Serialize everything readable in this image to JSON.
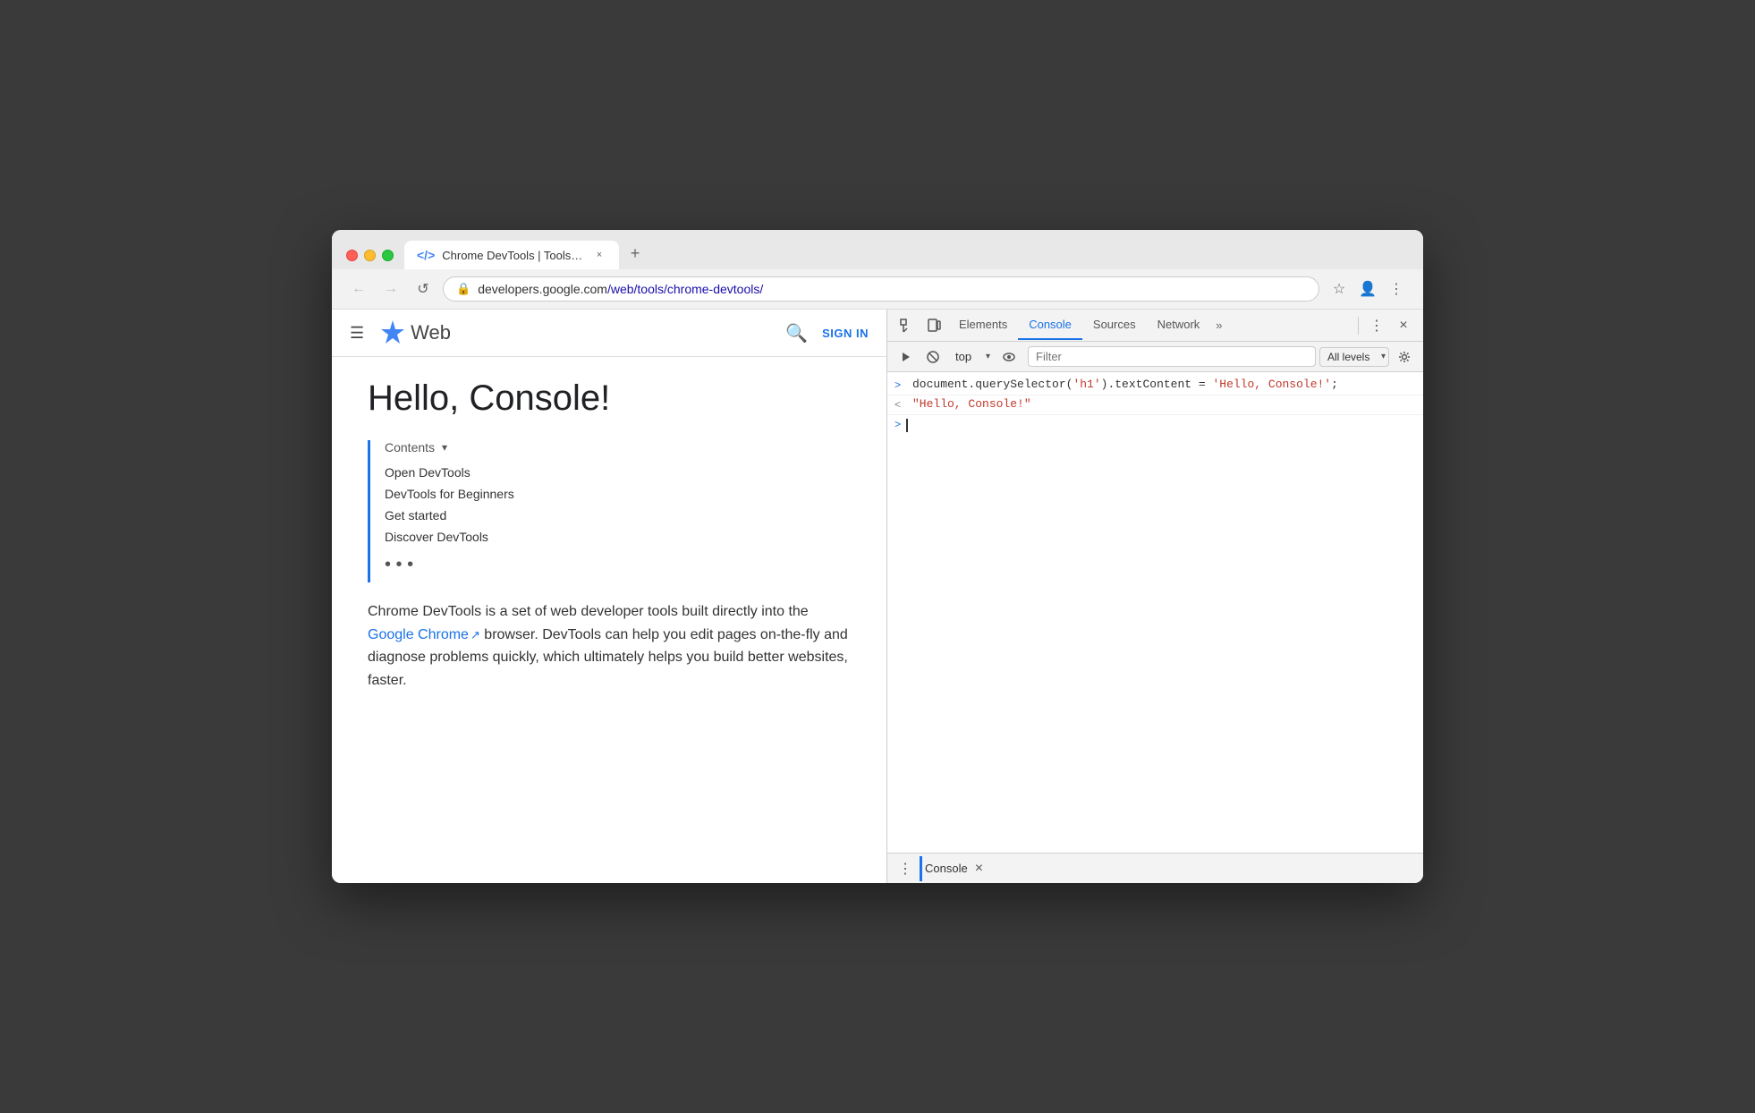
{
  "window": {
    "title": "Chrome DevTools | Tools for Web Developers | Google Developers",
    "tab_title": "Chrome DevTools | Tools for W",
    "url_protocol": "developers.google.com",
    "url_path": "/web/tools/chrome-devtools/",
    "url_display_start": "developers.google.com",
    "url_display_blue": "/web/tools/chrome-devtools/"
  },
  "page_nav": {
    "logo_text": "Web",
    "sign_in": "SIGN IN"
  },
  "article": {
    "heading": "Hello, Console!",
    "contents_label": "Contents",
    "contents_items": [
      "Open DevTools",
      "DevTools for Beginners",
      "Get started",
      "Discover DevTools"
    ],
    "more_dots": "• • •",
    "body_text_1": "Chrome DevTools is a set of web developer tools built directly into the ",
    "body_link": "Google Chrome",
    "body_text_2": " browser. DevTools can help you edit pages on-the-fly and diagnose problems quickly, which ultimately helps you build better websites, faster."
  },
  "devtools": {
    "tabs": [
      "Elements",
      "Console",
      "Sources",
      "Network"
    ],
    "active_tab": "Console",
    "more_tabs_label": "»",
    "context": "top",
    "filter_placeholder": "Filter",
    "filter_levels": "All levels",
    "console_lines": [
      {
        "arrow": ">",
        "type": "input",
        "code_before": "document.querySelector(",
        "string1": "'h1'",
        "code_middle": ").textContent = ",
        "string2": "'Hello, Console!'",
        "code_after": ";"
      },
      {
        "arrow": "<",
        "type": "output",
        "result": "\"Hello, Console!\""
      }
    ],
    "bottom_bar_label": "Console"
  },
  "icons": {
    "back": "←",
    "forward": "→",
    "reload": "↺",
    "lock": "🔒",
    "bookmark_star": "☆",
    "profile": "👤",
    "more_vert": "⋮",
    "hamburger": "☰",
    "search": "🔍",
    "element_picker": "⊡",
    "device_toolbar": "⬜",
    "clear_console": "🚫",
    "eye": "◉",
    "settings": "⚙",
    "play": "▶",
    "tab_icon": "<>",
    "tab_close": "×",
    "new_tab": "+",
    "devtools_close": "×",
    "chevron_down": "▾",
    "dots_menu": "⋮"
  },
  "colors": {
    "accent_blue": "#1a73e8",
    "tab_active_border": "#1a73e8",
    "console_input_color": "#333333",
    "console_string_color": "#c0392b",
    "console_arrow_blue": "#1a73e8"
  }
}
